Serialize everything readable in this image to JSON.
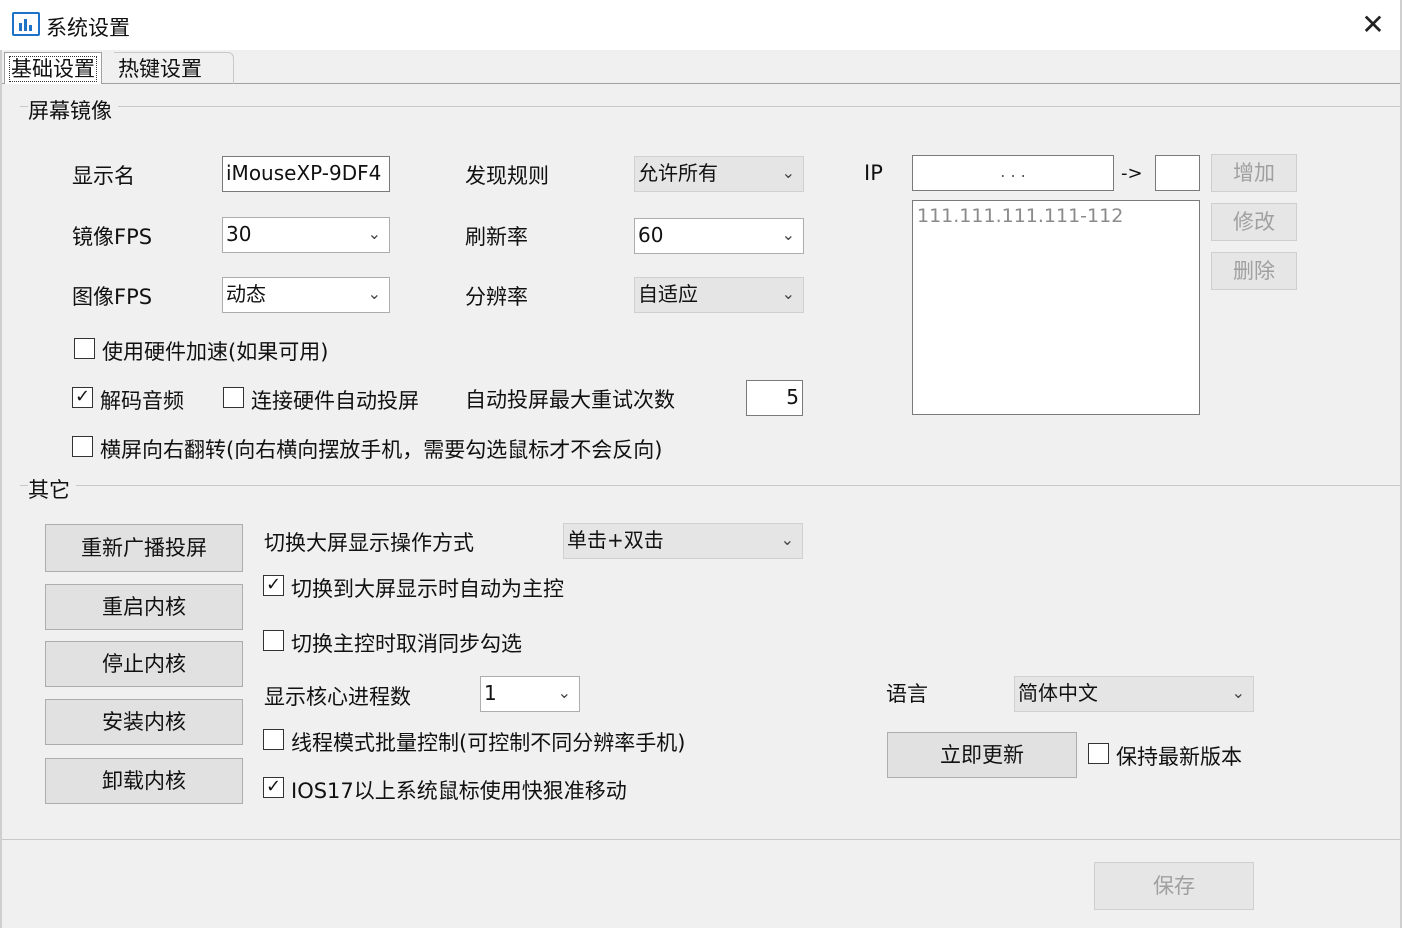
{
  "window": {
    "title": "系统设置",
    "close_glyph": "✕"
  },
  "tabs": [
    {
      "label": "基础设置",
      "active": true
    },
    {
      "label": "热键设置",
      "active": false
    }
  ],
  "mirror": {
    "group_title": "屏幕镜像",
    "display_name_label": "显示名",
    "display_name_value": "iMouseXP-9DF4",
    "mirror_fps_label": "镜像FPS",
    "mirror_fps_value": "30",
    "image_fps_label": "图像FPS",
    "image_fps_value": "动态",
    "discovery_label": "发现规则",
    "discovery_value": "允许所有",
    "refresh_label": "刷新率",
    "refresh_value": "60",
    "resolution_label": "分辨率",
    "resolution_value": "自适应",
    "ip_label": "IP",
    "ip_dots": ".   .   .",
    "ip_arrow": "->",
    "ip_list": [
      "111.111.111.111-112"
    ],
    "add_button": "增加",
    "edit_button": "修改",
    "delete_button": "删除",
    "hw_accel_label": "使用硬件加速(如果可用)",
    "hw_accel_checked": false,
    "decode_audio_label": "解码音频",
    "decode_audio_checked": true,
    "auto_cast_label": "连接硬件自动投屏",
    "auto_cast_checked": false,
    "max_retry_label": "自动投屏最大重试次数",
    "max_retry_value": "5",
    "landscape_flip_label": "横屏向右翻转(向右横向摆放手机，需要勾选鼠标才不会反向)",
    "landscape_flip_checked": false
  },
  "other": {
    "group_title": "其它",
    "rebroadcast_button": "重新广播投屏",
    "restart_kernel_button": "重启内核",
    "stop_kernel_button": "停止内核",
    "install_kernel_button": "安装内核",
    "uninstall_kernel_button": "卸载内核",
    "switch_mode_label": "切换大屏显示操作方式",
    "switch_mode_value": "单击+双击",
    "auto_master_label": "切换到大屏显示时自动为主控",
    "auto_master_checked": true,
    "cancel_sync_label": "切换主控时取消同步勾选",
    "cancel_sync_checked": false,
    "core_procs_label": "显示核心进程数",
    "core_procs_value": "1",
    "thread_mode_label": "线程模式批量控制(可控制不同分辨率手机)",
    "thread_mode_checked": false,
    "ios17_label": "IOS17以上系统鼠标使用快狠准移动",
    "ios17_checked": true,
    "language_label": "语言",
    "language_value": "简体中文",
    "update_button": "立即更新",
    "keep_latest_label": "保持最新版本",
    "keep_latest_checked": false
  },
  "footer": {
    "save_button": "保存"
  },
  "glyphs": {
    "check": "✓",
    "arrow": "⌄"
  }
}
